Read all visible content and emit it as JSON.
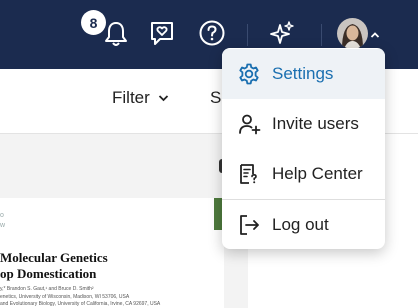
{
  "header": {
    "notification_count": "8",
    "icons": [
      "bell-icon",
      "heart-message-icon",
      "help-icon",
      "sparkle-icon",
      "avatar",
      "chevron-down-icon"
    ]
  },
  "toolbar": {
    "filter_label": "Filter",
    "sort_label_partial": "S"
  },
  "document": {
    "kicker_line1": "o",
    "kicker_line2": "w",
    "title_line1": "Molecular Genetics",
    "title_line2": "op Domestication",
    "authors": "y,* Brandon S. Gaut,¹ and Bruce D. Smith²",
    "affiliation1": "enetics, University of Wisconsin, Madison, WI 53706, USA",
    "affiliation2": "and Evolutionary Biology, University of California, Irvine, CA 92697, USA"
  },
  "menu": {
    "items": [
      {
        "label": "Settings",
        "icon": "gear-icon",
        "active": true
      },
      {
        "label": "Invite users",
        "icon": "add-user-icon",
        "active": false
      },
      {
        "label": "Help Center",
        "icon": "help-document-icon",
        "active": false
      },
      {
        "label": "Log out",
        "icon": "logout-icon",
        "active": false
      }
    ]
  },
  "colors": {
    "header_bg": "#1b2b4f",
    "accent": "#1a6fb0",
    "active_item_bg": "#eef2f6"
  }
}
